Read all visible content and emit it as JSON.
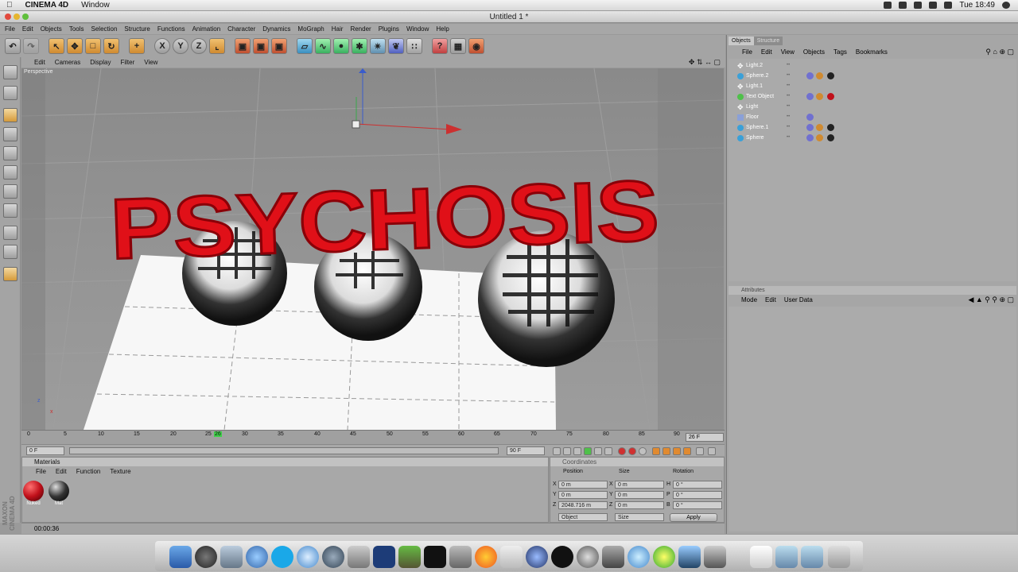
{
  "mac_menubar": {
    "app_name": "CINEMA 4D",
    "menu": "Window",
    "clock": "Tue 18:49"
  },
  "window": {
    "title": "Untitled 1 *"
  },
  "app_menu": [
    "File",
    "Edit",
    "Objects",
    "Tools",
    "Selection",
    "Structure",
    "Functions",
    "Animation",
    "Character",
    "Dynamics",
    "MoGraph",
    "Hair",
    "Render",
    "Plugins",
    "Window",
    "Help"
  ],
  "toolbar": {
    "axis_x": "X",
    "axis_y": "Y",
    "axis_z": "Z"
  },
  "viewport": {
    "menu": [
      "Edit",
      "Cameras",
      "Display",
      "Filter",
      "View"
    ],
    "label": "Perspective",
    "scene_text": "PSYCHOSIS"
  },
  "timeline": {
    "ticks": [
      "0",
      "5",
      "10",
      "15",
      "20",
      "25",
      "26",
      "30",
      "35",
      "40",
      "45",
      "50",
      "55",
      "60",
      "65",
      "70",
      "75",
      "80",
      "85",
      "90"
    ],
    "current_frame": "26 F",
    "start_field": "0 F",
    "end_field": "90 F"
  },
  "materials": {
    "title": "Materials",
    "menu": [
      "File",
      "Edit",
      "Function",
      "Texture"
    ],
    "items": [
      {
        "name": "Nuked",
        "color": "#c0101a"
      },
      {
        "name": "Mat",
        "color": "#222222"
      }
    ]
  },
  "coordinates": {
    "title": "Coordinates",
    "headers": [
      "Position",
      "Size",
      "Rotation"
    ],
    "position": {
      "x": "0 m",
      "y": "0 m",
      "z": "2048.716 m"
    },
    "size": {
      "x": "0 m",
      "y": "0 m",
      "z": "0 m"
    },
    "rotation": {
      "h": "0 °",
      "p": "0 °",
      "b": "0 °"
    },
    "axis_labels": {
      "x": "X",
      "y": "Y",
      "z": "Z",
      "h": "H",
      "p": "P",
      "b": "B"
    },
    "mode_select": "Object",
    "size_select": "Size",
    "apply_label": "Apply"
  },
  "status": {
    "time": "00:00:36"
  },
  "branding": {
    "maxon": "MAXON CINEMA 4D"
  },
  "object_manager": {
    "tabs": [
      "Objects",
      "Structure"
    ],
    "menu": [
      "File",
      "Edit",
      "View",
      "Objects",
      "Tags",
      "Bookmarks"
    ],
    "objects": [
      {
        "name": "Light.2",
        "icon": "light-icon"
      },
      {
        "name": "Sphere.2",
        "icon": "sphere-icon"
      },
      {
        "name": "Light.1",
        "icon": "light-icon"
      },
      {
        "name": "Text Object",
        "icon": "text-object-icon"
      },
      {
        "name": "Light",
        "icon": "light-icon"
      },
      {
        "name": "Floor",
        "icon": "floor-icon"
      },
      {
        "name": "Sphere.1",
        "icon": "sphere-icon"
      },
      {
        "name": "Sphere",
        "icon": "sphere-icon"
      }
    ]
  },
  "attributes": {
    "title": "Attributes",
    "menu": [
      "Mode",
      "Edit",
      "User Data"
    ]
  }
}
